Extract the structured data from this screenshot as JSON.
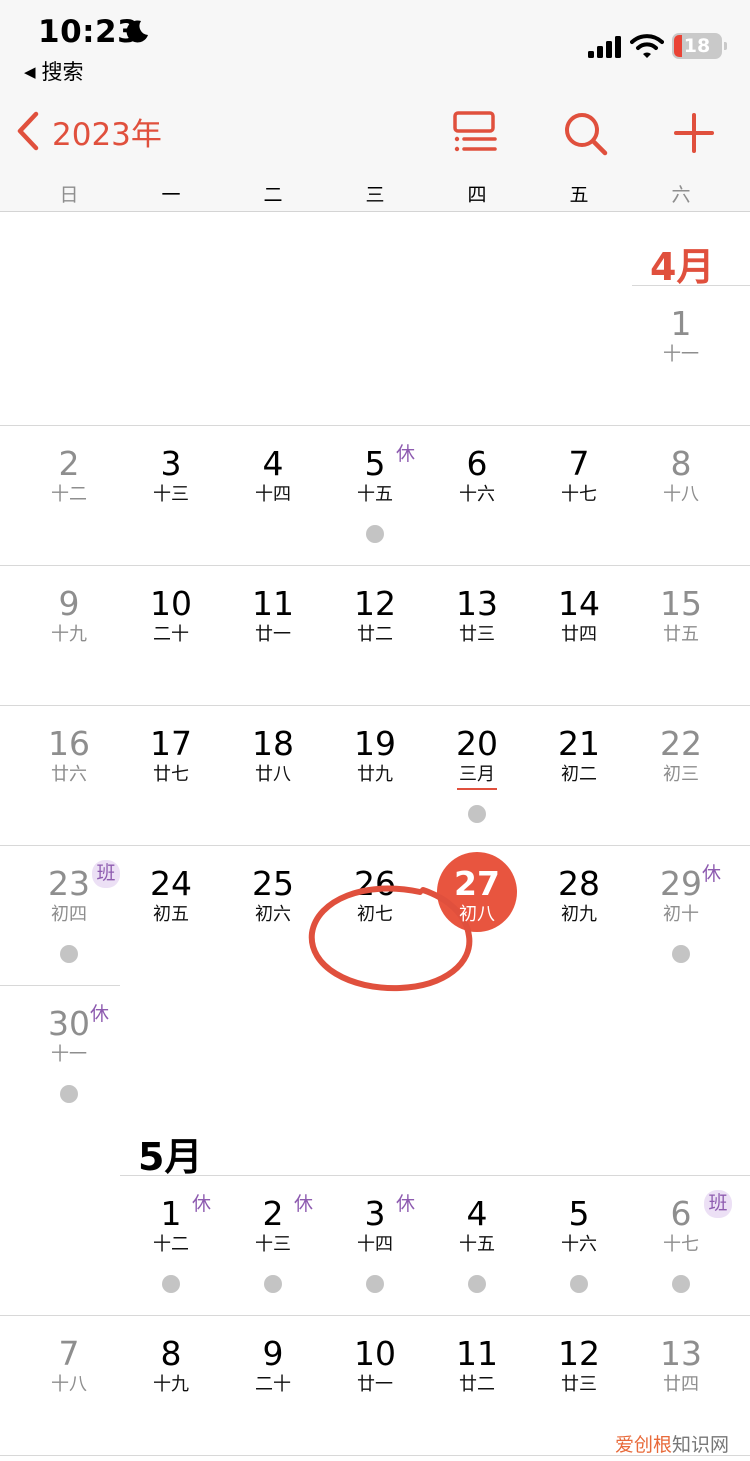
{
  "status_bar": {
    "time": "10:23",
    "back_app": "搜索",
    "battery": "18"
  },
  "nav": {
    "year": "2023年"
  },
  "weekdays": [
    "日",
    "一",
    "二",
    "三",
    "四",
    "五",
    "六"
  ],
  "months": {
    "april": "4月",
    "may": "5月"
  },
  "april": [
    {
      "n": "1",
      "l": "十一"
    },
    {
      "n": "2",
      "l": "十二"
    },
    {
      "n": "3",
      "l": "十三"
    },
    {
      "n": "4",
      "l": "十四"
    },
    {
      "n": "5",
      "l": "十五",
      "b": "休"
    },
    {
      "n": "6",
      "l": "十六"
    },
    {
      "n": "7",
      "l": "十七"
    },
    {
      "n": "8",
      "l": "十八"
    },
    {
      "n": "9",
      "l": "十九"
    },
    {
      "n": "10",
      "l": "二十"
    },
    {
      "n": "11",
      "l": "廿一"
    },
    {
      "n": "12",
      "l": "廿二"
    },
    {
      "n": "13",
      "l": "廿三"
    },
    {
      "n": "14",
      "l": "廿四"
    },
    {
      "n": "15",
      "l": "廿五"
    },
    {
      "n": "16",
      "l": "廿六"
    },
    {
      "n": "17",
      "l": "廿七"
    },
    {
      "n": "18",
      "l": "廿八"
    },
    {
      "n": "19",
      "l": "廿九"
    },
    {
      "n": "20",
      "l": "三月"
    },
    {
      "n": "21",
      "l": "初二"
    },
    {
      "n": "22",
      "l": "初三"
    },
    {
      "n": "23",
      "l": "初四",
      "b": "班"
    },
    {
      "n": "24",
      "l": "初五"
    },
    {
      "n": "25",
      "l": "初六"
    },
    {
      "n": "26",
      "l": "初七"
    },
    {
      "n": "27",
      "l": "初八"
    },
    {
      "n": "28",
      "l": "初九"
    },
    {
      "n": "29",
      "l": "初十",
      "b": "休"
    },
    {
      "n": "30",
      "l": "十一",
      "b": "休"
    }
  ],
  "may": [
    {
      "n": "1",
      "l": "十二",
      "b": "休"
    },
    {
      "n": "2",
      "l": "十三",
      "b": "休"
    },
    {
      "n": "3",
      "l": "十四",
      "b": "休"
    },
    {
      "n": "4",
      "l": "十五"
    },
    {
      "n": "5",
      "l": "十六"
    },
    {
      "n": "6",
      "l": "十七",
      "b": "班"
    },
    {
      "n": "7",
      "l": "十八"
    },
    {
      "n": "8",
      "l": "十九"
    },
    {
      "n": "9",
      "l": "二十"
    },
    {
      "n": "10",
      "l": "廿一"
    },
    {
      "n": "11",
      "l": "廿二"
    },
    {
      "n": "12",
      "l": "廿三"
    },
    {
      "n": "13",
      "l": "廿四"
    }
  ],
  "watermark": {
    "brand": "爱创根",
    "suffix": "知识网"
  },
  "colors": {
    "accent": "#e0503d",
    "badge": "#8e5cb0",
    "event_dot": "#c4c4c4",
    "weekend": "#8e8e8e"
  }
}
